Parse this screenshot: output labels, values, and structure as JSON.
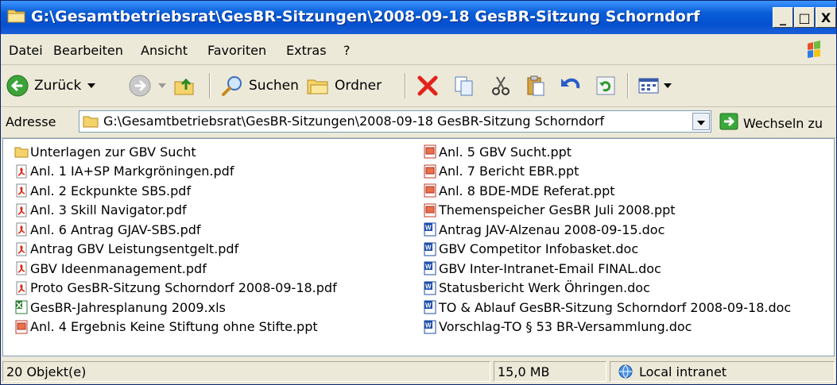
{
  "window": {
    "title": "G:\\Gesamtbetriebsrat\\GesBR-Sitzungen\\2008-09-18 GesBR-Sitzung Schorndorf",
    "buttons": {
      "minimize": "_",
      "maximize": "□",
      "close": "X"
    }
  },
  "menu": [
    "Datei",
    "Bearbeiten",
    "Ansicht",
    "Favoriten",
    "Extras",
    "?"
  ],
  "toolbar": {
    "back_label": "Zurück",
    "search_label": "Suchen",
    "folders_label": "Ordner"
  },
  "address": {
    "label": "Adresse",
    "value": "G:\\Gesamtbetriebsrat\\GesBR-Sitzungen\\2008-09-18 GesBR-Sitzung Schorndorf",
    "go_label": "Wechseln zu"
  },
  "files_left": [
    {
      "name": "Unterlagen zur GBV Sucht",
      "icon": "folder-icon"
    },
    {
      "name": "Anl. 1 IA+SP Markgröningen.pdf",
      "icon": "pdf-icon"
    },
    {
      "name": "Anl. 2 Eckpunkte SBS.pdf",
      "icon": "pdf-icon"
    },
    {
      "name": "Anl. 3 Skill Navigator.pdf",
      "icon": "pdf-icon"
    },
    {
      "name": "Anl. 6 Antrag GJAV-SBS.pdf",
      "icon": "pdf-icon"
    },
    {
      "name": "Antrag GBV Leistungsentgelt.pdf",
      "icon": "pdf-icon"
    },
    {
      "name": "GBV Ideenmanagement.pdf",
      "icon": "pdf-icon"
    },
    {
      "name": "Proto GesBR-Sitzung Schorndorf 2008-09-18.pdf",
      "icon": "pdf-icon"
    },
    {
      "name": "GesBR-Jahresplanung 2009.xls",
      "icon": "excel-icon"
    },
    {
      "name": "Anl. 4 Ergebnis Keine Stiftung ohne Stifte.ppt",
      "icon": "powerpoint-icon"
    }
  ],
  "files_right": [
    {
      "name": "Anl. 5 GBV Sucht.ppt",
      "icon": "powerpoint-icon"
    },
    {
      "name": "Anl. 7 Bericht EBR.ppt",
      "icon": "powerpoint-icon"
    },
    {
      "name": "Anl. 8 BDE-MDE Referat.ppt",
      "icon": "powerpoint-icon"
    },
    {
      "name": "Themenspeicher GesBR Juli 2008.ppt",
      "icon": "powerpoint-icon"
    },
    {
      "name": "Antrag JAV-Alzenau 2008-09-15.doc",
      "icon": "word-icon"
    },
    {
      "name": "GBV Competitor Infobasket.doc",
      "icon": "word-icon"
    },
    {
      "name": "GBV Inter-Intranet-Email FINAL.doc",
      "icon": "word-icon"
    },
    {
      "name": "Statusbericht Werk Öhringen.doc",
      "icon": "word-icon"
    },
    {
      "name": "TO & Ablauf GesBR-Sitzung Schorndorf 2008-09-18.doc",
      "icon": "word-icon"
    },
    {
      "name": "Vorschlag-TO § 53 BR-Versammlung.doc",
      "icon": "word-icon"
    }
  ],
  "status": {
    "count": "20 Objekt(e)",
    "size": "15,0 MB",
    "zone": "Local intranet"
  }
}
